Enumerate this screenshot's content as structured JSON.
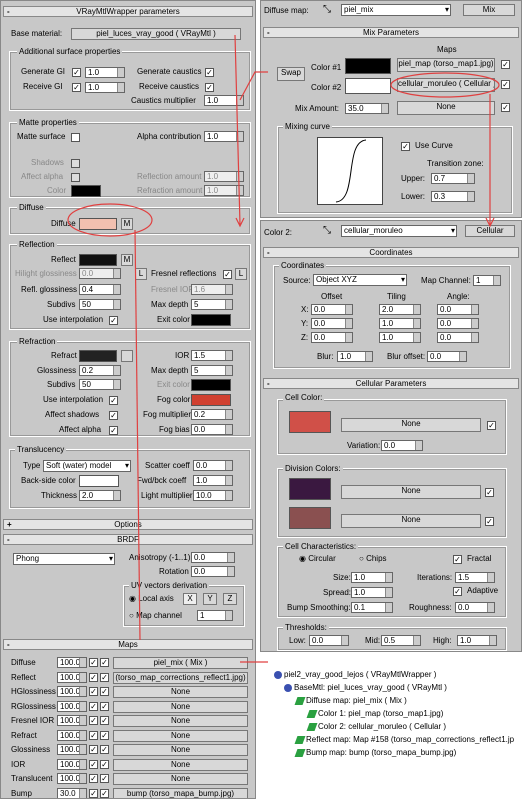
{
  "left": {
    "title": "VRayMtlWrapper parameters",
    "base_material_label": "Base material:",
    "base_material_value": "piel_luces_vray_good  ( VRayMtl )",
    "add_surface": "Additional surface properties",
    "gen_gi": "Generate GI",
    "gen_gi_val": "1.0",
    "recv_gi": "Receive GI",
    "recv_gi_val": "1.0",
    "gen_caustics": "Generate caustics",
    "recv_caustics": "Receive caustics",
    "caust_mult": "Caustics multiplier",
    "caust_mult_val": "1.0",
    "matte": "Matte properties",
    "matte_surface": "Matte surface",
    "alpha_contrib": "Alpha contribution",
    "alpha_contrib_val": "1.0",
    "shadows": "Shadows",
    "affect_alpha": "Affect alpha",
    "color": "Color",
    "refl_amount": "Reflection amount",
    "refl_amount_val": "1.0",
    "refr_amount": "Refraction amount",
    "refr_amount_val": "1.0",
    "diffuse_grp": "Diffuse",
    "diffuse": "Diffuse",
    "m": "M",
    "reflection_grp": "Reflection",
    "reflect": "Reflect",
    "hilight": "Hilight glossiness",
    "hilight_val": "0.0",
    "l": "L",
    "fresnel": "Fresnel reflections",
    "refl_gloss": "Refl. glossiness",
    "refl_gloss_val": "0.4",
    "fresnel_ior": "Fresnel IOR",
    "fresnel_ior_val": "1.6",
    "subdivs": "Subdivs",
    "subdivs_val": "50",
    "max_depth": "Max depth",
    "max_depth_val": "5",
    "use_interp": "Use interpolation",
    "exit_color": "Exit color",
    "refraction_grp": "Refraction",
    "refract": "Refract",
    "ior": "IOR",
    "ior_val": "1.5",
    "glossiness": "Glossiness",
    "glossiness_val": "0.2",
    "r_subdivs_val": "50",
    "r_max_depth_val": "5",
    "fog_color": "Fog color",
    "affect_shadows": "Affect shadows",
    "fog_mult": "Fog multiplier",
    "fog_mult_val": "0.2",
    "affect_alpha2": "Affect alpha",
    "fog_bias": "Fog bias",
    "fog_bias_val": "0.0",
    "transl_grp": "Translucency",
    "type": "Type",
    "type_val": "Soft (water) model",
    "scatter": "Scatter coeff",
    "scatter_val": "0.0",
    "backside": "Back-side color",
    "fwd": "Fwd/bck coeff",
    "fwd_val": "1.0",
    "thickness": "Thickness",
    "thickness_val": "2.0",
    "light_mult": "Light multiplier",
    "light_mult_val": "10.0",
    "options": "Options",
    "brdf": "BRDF",
    "phong": "Phong",
    "aniso": "Anisotropy (-1..1)",
    "aniso_val": "0.0",
    "rotation": "Rotation",
    "rotation_val": "0.0",
    "uv_deriv": "UV vectors derivation",
    "local_axis": "Local axis",
    "x": "X",
    "y": "Y",
    "z": "Z",
    "map_channel": "Map channel",
    "map_channel_val": "1",
    "maps": "Maps",
    "map_rows": [
      {
        "n": "Diffuse",
        "v": "100.0",
        "m": "piel_mix  ( Mix )"
      },
      {
        "n": "Reflect",
        "v": "100.0",
        "m": "(torso_map_corrections_reflect1.jpg)"
      },
      {
        "n": "HGlossiness",
        "v": "100.0",
        "m": "None"
      },
      {
        "n": "RGlossiness",
        "v": "100.0",
        "m": "None"
      },
      {
        "n": "Fresnel IOR",
        "v": "100.0",
        "m": "None"
      },
      {
        "n": "Refract",
        "v": "100.0",
        "m": "None"
      },
      {
        "n": "Glossiness",
        "v": "100.0",
        "m": "None"
      },
      {
        "n": "IOR",
        "v": "100.0",
        "m": "None"
      },
      {
        "n": "Translucent",
        "v": "100.0",
        "m": "None"
      },
      {
        "n": "Bump",
        "v": "30.0",
        "m": "bump (torso_mapa_bump.jpg)"
      }
    ]
  },
  "mix": {
    "diffuse_map": "Diffuse map:",
    "name": "piel_mix",
    "type": "Mix",
    "header": "Mix Parameters",
    "maps": "Maps",
    "swap": "Swap",
    "color1": "Color #1",
    "map1": "piel_map (torso_map1.jpg)",
    "color2": "Color #2",
    "map2": "cellular_moruleo  ( Cellular )",
    "mix_amount": "Mix Amount:",
    "mix_val": "35.0",
    "none": "None",
    "curve": "Mixing curve",
    "use_curve": "Use Curve",
    "trans": "Transition zone:",
    "upper": "Upper:",
    "upper_val": "0.7",
    "lower": "Lower:",
    "lower_val": "0.3"
  },
  "cell": {
    "color2": "Color 2:",
    "name": "cellular_moruleo",
    "type": "Cellular",
    "coords": "Coordinates",
    "coords_grp": "Coordinates",
    "source": "Source:",
    "source_val": "Object XYZ",
    "map_channel": "Map Channel:",
    "map_channel_val": "1",
    "offset": "Offset",
    "tiling": "Tiling",
    "angle": "Angle:",
    "xl": "X:",
    "yl": "Y:",
    "zl": "Z:",
    "ox": "0.0",
    "oy": "0.0",
    "oz": "0.0",
    "tx": "2.0",
    "ty": "1.0",
    "tz": "1.0",
    "ax": "0.0",
    "ay": "0.0",
    "az": "0.0",
    "blur": "Blur:",
    "blur_val": "1.0",
    "blur_off": "Blur offset:",
    "blur_off_val": "0.0",
    "cell_params": "Cellular Parameters",
    "cell_color": "Cell Color:",
    "none": "None",
    "variation": "Variation:",
    "variation_val": "0.0",
    "division": "Division Colors:",
    "cell_char": "Cell Characteristics:",
    "circular": "Circular",
    "chips": "Chips",
    "fractal": "Fractal",
    "size": "Size:",
    "size_val": "1.0",
    "iterations": "Iterations:",
    "iterations_val": "1.5",
    "spread": "Spread:",
    "spread_val": "1.0",
    "adaptive": "Adaptive",
    "bump_smooth": "Bump Smoothing:",
    "bump_smooth_val": "0.1",
    "roughness": "Roughness:",
    "roughness_val": "0.0",
    "thresholds": "Thresholds:",
    "low": "Low:",
    "low_val": "0.0",
    "mid": "Mid:",
    "mid_val": "0.5",
    "high": "High:",
    "high_val": "1.0"
  },
  "tree": [
    "piel2_vray_good_lejos  ( VRayMtlWrapper )",
    "BaseMtl: piel_luces_vray_good  ( VRayMtl )",
    "Diffuse map: piel_mix  ( Mix )",
    "Color 1: piel_map (torso_map1.jpg)",
    "Color 2: cellular_moruleo  ( Cellular )",
    "Reflect map: Map #158 (torso_map_corrections_reflect1.jp",
    "Bump map: bump (torso_mapa_bump.jpg)"
  ],
  "colors": {
    "diffuse": "#f2c0b0",
    "fog": "#d04030",
    "cell": "#d05048",
    "div1": "#3a1840",
    "div2": "#8a5050"
  }
}
